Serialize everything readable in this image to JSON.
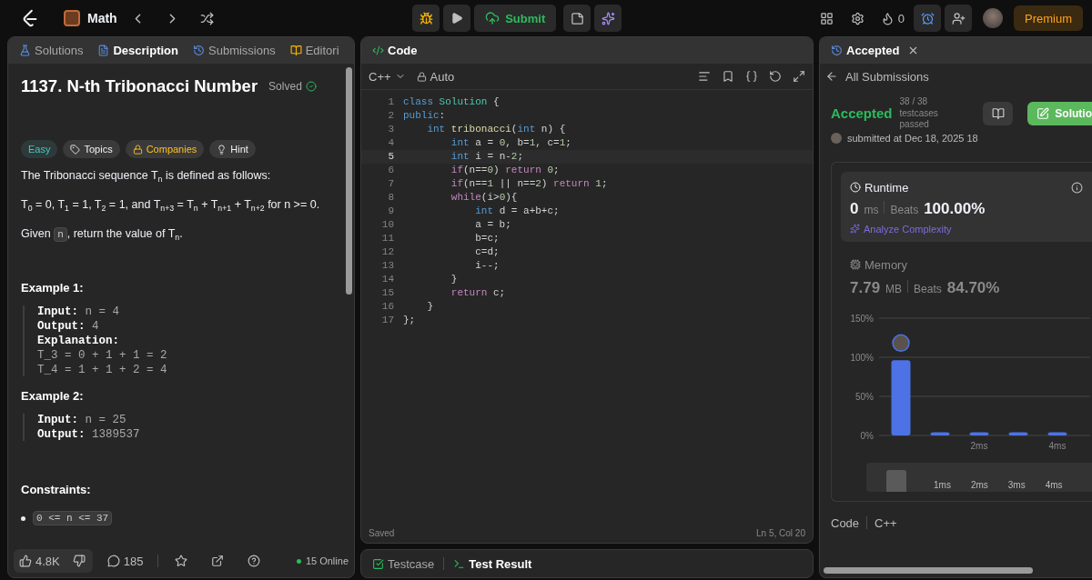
{
  "topbar": {
    "problem_list": "Math",
    "submit": "Submit",
    "streak": "0",
    "premium": "Premium"
  },
  "left_panel": {
    "tabs": [
      {
        "label": "Solutions",
        "selected": false
      },
      {
        "label": "Description",
        "selected": true
      },
      {
        "label": "Submissions",
        "selected": false
      },
      {
        "label": "Editori",
        "selected": false
      }
    ],
    "title": "1137. N-th Tribonacci Number",
    "status": "Solved",
    "tags": [
      {
        "label": "Easy",
        "kind": "difficulty"
      },
      {
        "label": "Topics",
        "kind": "tag"
      },
      {
        "label": "Companies",
        "kind": "lock"
      },
      {
        "label": "Hint",
        "kind": "bulb"
      }
    ],
    "paragraphs": [
      "The Tribonacci sequence T$_{n}$ is defined as follows:",
      "T$_{0}$ = 0, T$_{1}$ = 1, T$_{2}$ = 1, and T$_{n+3}$ = T$_{n}$ + T$_{n+1}$ + T$_{n+2}$ for n >= 0."
    ],
    "given": {
      "before": "Given",
      "code": "n",
      "after": ", return the value of T$_{n}$."
    },
    "examples": [
      {
        "title": "Example 1:",
        "lines": [
          {
            "label": "Input:",
            "value": "n = 4"
          },
          {
            "label": "Output:",
            "value": "4"
          },
          {
            "label": "Explanation:"
          },
          {
            "value": "T_3 = 0 + 1 + 1 = 2"
          },
          {
            "value": "T_4 = 1 + 1 + 2 = 4"
          }
        ]
      },
      {
        "title": "Example 2:",
        "lines": [
          {
            "label": "Input:",
            "value": "n = 25"
          },
          {
            "label": "Output:",
            "value": "1389537"
          }
        ]
      }
    ],
    "constraints_title": "Constraints:",
    "constraints": [
      "0 <= n <= 37"
    ],
    "footer": {
      "likes": "4.8K",
      "comments": "185",
      "online": "15 Online"
    }
  },
  "code_panel": {
    "title": "Code",
    "language": "C++",
    "mode": "Auto",
    "lines": [
      {
        "number": "1",
        "current": false,
        "tokens": [
          {
            "kind": "keyword",
            "text": "class"
          },
          {
            "kind": "type",
            "text": " Solution"
          },
          {
            "kind": "plain",
            "text": " {"
          }
        ]
      },
      {
        "number": "2",
        "current": false,
        "tokens": [
          {
            "kind": "keyword",
            "text": "public"
          },
          {
            "kind": "plain",
            "text": ":"
          }
        ]
      },
      {
        "number": "3",
        "current": false,
        "tokens": [
          {
            "kind": "keyword",
            "text": "    int"
          },
          {
            "kind": "function",
            "text": " tribonacci"
          },
          {
            "kind": "plain",
            "text": "("
          },
          {
            "kind": "keyword",
            "text": "int"
          },
          {
            "kind": "plain",
            "text": " n) {"
          }
        ]
      },
      {
        "number": "4",
        "current": false,
        "tokens": [
          {
            "kind": "keyword",
            "text": "        int"
          },
          {
            "kind": "plain",
            "text": " a = "
          },
          {
            "kind": "number",
            "text": "0"
          },
          {
            "kind": "plain",
            "text": ", b="
          },
          {
            "kind": "number",
            "text": "1"
          },
          {
            "kind": "plain",
            "text": ", c="
          },
          {
            "kind": "number",
            "text": "1"
          },
          {
            "kind": "plain",
            "text": ";"
          }
        ]
      },
      {
        "number": "5",
        "current": true,
        "tokens": [
          {
            "kind": "keyword",
            "text": "        int"
          },
          {
            "kind": "plain",
            "text": " i = n-"
          },
          {
            "kind": "number",
            "text": "2"
          },
          {
            "kind": "plain",
            "text": ";"
          }
        ]
      },
      {
        "number": "6",
        "current": false,
        "tokens": [
          {
            "kind": "control",
            "text": "        if"
          },
          {
            "kind": "plain",
            "text": "(n=="
          },
          {
            "kind": "number",
            "text": "0"
          },
          {
            "kind": "plain",
            "text": ")"
          },
          {
            "kind": "control",
            "text": " return"
          },
          {
            "kind": "number",
            "text": " 0"
          },
          {
            "kind": "plain",
            "text": ";"
          }
        ]
      },
      {
        "number": "7",
        "current": false,
        "tokens": [
          {
            "kind": "control",
            "text": "        if"
          },
          {
            "kind": "plain",
            "text": "(n=="
          },
          {
            "kind": "number",
            "text": "1"
          },
          {
            "kind": "plain",
            "text": " || n=="
          },
          {
            "kind": "number",
            "text": "2"
          },
          {
            "kind": "plain",
            "text": ")"
          },
          {
            "kind": "control",
            "text": " return"
          },
          {
            "kind": "number",
            "text": " 1"
          },
          {
            "kind": "plain",
            "text": ";"
          }
        ]
      },
      {
        "number": "8",
        "current": false,
        "tokens": [
          {
            "kind": "control",
            "text": "        while"
          },
          {
            "kind": "plain",
            "text": "(i>"
          },
          {
            "kind": "number",
            "text": "0"
          },
          {
            "kind": "plain",
            "text": "){"
          }
        ]
      },
      {
        "number": "9",
        "current": false,
        "tokens": [
          {
            "kind": "keyword",
            "text": "            int"
          },
          {
            "kind": "plain",
            "text": " d = a+b+c;"
          }
        ]
      },
      {
        "number": "10",
        "current": false,
        "tokens": [
          {
            "kind": "plain",
            "text": "            a = b;"
          }
        ]
      },
      {
        "number": "11",
        "current": false,
        "tokens": [
          {
            "kind": "plain",
            "text": "            b=c;"
          }
        ]
      },
      {
        "number": "12",
        "current": false,
        "tokens": [
          {
            "kind": "plain",
            "text": "            c=d;"
          }
        ]
      },
      {
        "number": "13",
        "current": false,
        "tokens": [
          {
            "kind": "plain",
            "text": "            i--;"
          }
        ]
      },
      {
        "number": "14",
        "current": false,
        "tokens": [
          {
            "kind": "plain",
            "text": "        }"
          }
        ]
      },
      {
        "number": "15",
        "current": false,
        "tokens": [
          {
            "kind": "control",
            "text": "        return"
          },
          {
            "kind": "plain",
            "text": " c;"
          }
        ]
      },
      {
        "number": "16",
        "current": false,
        "tokens": [
          {
            "kind": "plain",
            "text": "    }"
          }
        ]
      },
      {
        "number": "17",
        "current": false,
        "tokens": [
          {
            "kind": "plain",
            "text": "};"
          }
        ]
      }
    ],
    "saved": "Saved",
    "cursor": "Ln 5, Col 20"
  },
  "bottom_tabs": [
    {
      "label": "Testcase",
      "selected": false
    },
    {
      "label": "Test Result",
      "selected": true
    }
  ],
  "result_panel": {
    "tab": "Accepted",
    "back": "All Submissions",
    "verdict": "Accepted",
    "testcases": "38 / 38 testcases passed",
    "solution_button": "Solutio",
    "submitted": "submitted at Dec 18, 2025 18",
    "runtime": {
      "title": "Runtime",
      "value": "0",
      "unit": "ms",
      "beats_label": "Beats",
      "beats": "100.00%",
      "analyze": "Analyze Complexity"
    },
    "memory": {
      "title": "Memory",
      "value": "7.79",
      "unit": "MB",
      "beats_label": "Beats",
      "beats": "84.70%"
    },
    "chart_data": {
      "type": "bar",
      "categories": [
        null,
        null,
        "2ms",
        null,
        "4ms"
      ],
      "series": [
        {
          "color": "#4c72e6",
          "values": [
            95,
            3,
            3,
            3,
            3
          ]
        }
      ],
      "ylim": [
        0,
        150
      ],
      "yticks": [
        {
          "value": 0,
          "label": "0%"
        },
        {
          "value": 50,
          "label": "50%"
        },
        {
          "value": 100,
          "label": "100%"
        },
        {
          "value": 150,
          "label": "150%"
        }
      ]
    },
    "navigator_labels": [
      "1ms",
      "2ms",
      "3ms",
      "4ms"
    ],
    "code_label": "Code",
    "code_language": "C++"
  }
}
